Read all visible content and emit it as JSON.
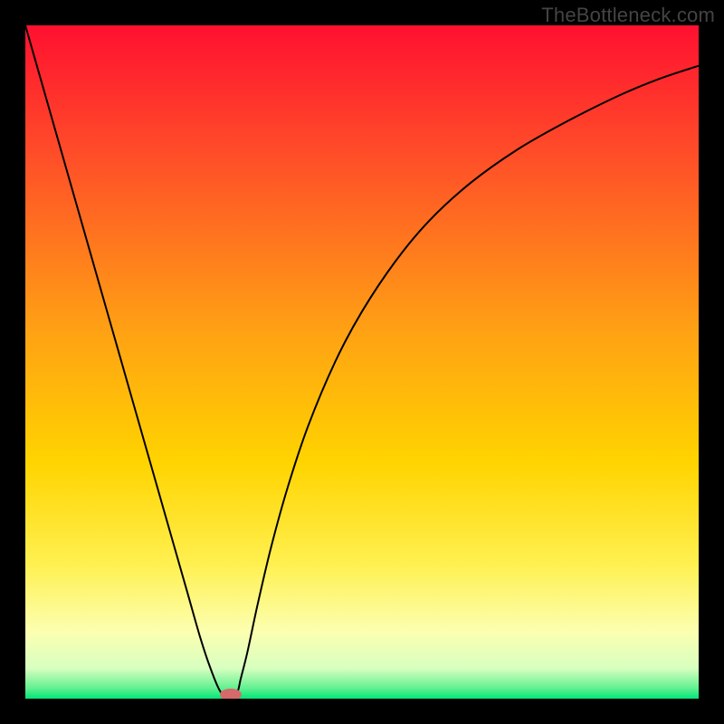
{
  "watermark": "TheBottleneck.com",
  "chart_data": {
    "type": "line",
    "title": "",
    "xlabel": "",
    "ylabel": "",
    "xlim": [
      0,
      100
    ],
    "ylim": [
      0,
      100
    ],
    "background_gradient": {
      "type": "vertical",
      "stops": [
        {
          "pos": 0.0,
          "color": "#ff1030"
        },
        {
          "pos": 0.2,
          "color": "#ff5028"
        },
        {
          "pos": 0.45,
          "color": "#ffa014"
        },
        {
          "pos": 0.65,
          "color": "#ffd400"
        },
        {
          "pos": 0.8,
          "color": "#fff050"
        },
        {
          "pos": 0.9,
          "color": "#fcffb0"
        },
        {
          "pos": 0.955,
          "color": "#d8ffc0"
        },
        {
          "pos": 0.985,
          "color": "#60f090"
        },
        {
          "pos": 1.0,
          "color": "#00e676"
        }
      ]
    },
    "series": [
      {
        "name": "curve",
        "color": "#000000",
        "x": [
          0.0,
          3.0,
          6.0,
          9.0,
          12.0,
          15.0,
          18.0,
          21.0,
          24.0,
          26.0,
          27.5,
          29.0,
          30.5,
          31.5,
          32.0,
          33.0,
          34.5,
          36.5,
          39.0,
          42.0,
          46.0,
          50.0,
          55.0,
          60.0,
          66.0,
          73.0,
          80.0,
          88.0,
          94.0,
          100.0
        ],
        "y": [
          100.0,
          89.5,
          79.0,
          68.5,
          58.0,
          47.5,
          37.0,
          26.5,
          16.0,
          9.0,
          4.5,
          1.0,
          0.0,
          1.0,
          3.0,
          7.0,
          14.0,
          22.5,
          31.5,
          40.5,
          50.0,
          57.5,
          65.0,
          71.0,
          76.5,
          81.5,
          85.5,
          89.5,
          92.0,
          94.0
        ]
      }
    ],
    "marker": {
      "name": "min-point",
      "x": 30.5,
      "y": 0.6,
      "rx": 1.6,
      "ry": 0.9,
      "color": "#d66a6a"
    }
  }
}
